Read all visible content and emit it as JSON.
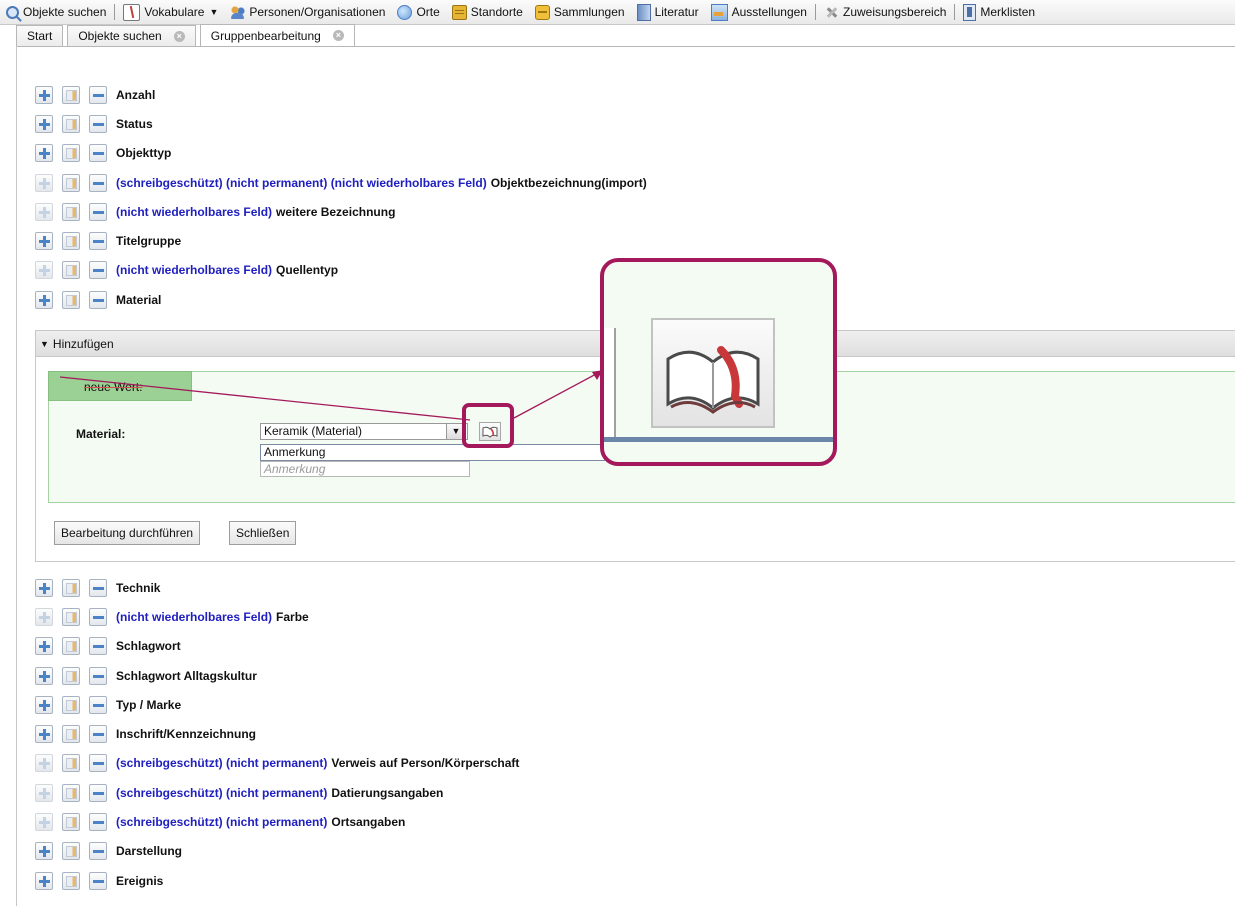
{
  "toolbar": {
    "items": [
      {
        "label": "Objekte suchen",
        "icon": "search-icon"
      },
      {
        "label": "Vokabulare",
        "icon": "book-icon",
        "dropdown": true
      },
      {
        "label": "Personen/Organisationen",
        "icon": "people-icon"
      },
      {
        "label": "Orte",
        "icon": "globe-icon"
      },
      {
        "label": "Standorte",
        "icon": "box-icon"
      },
      {
        "label": "Sammlungen",
        "icon": "collection-icon"
      },
      {
        "label": "Literatur",
        "icon": "literature-icon"
      },
      {
        "label": "Ausstellungen",
        "icon": "exhibition-icon"
      },
      {
        "label": "Zuweisungsbereich",
        "icon": "tools-icon"
      },
      {
        "label": "Merklisten",
        "icon": "watchlist-icon"
      }
    ]
  },
  "tabs": [
    {
      "label": "Start",
      "closable": false
    },
    {
      "label": "Objekte suchen",
      "closable": true
    },
    {
      "label": "Gruppenbearbeitung",
      "closable": true,
      "active": true
    }
  ],
  "fields_top": [
    {
      "prefix": "",
      "label": "Anzahl",
      "enabled": true
    },
    {
      "prefix": "",
      "label": "Status",
      "enabled": true
    },
    {
      "prefix": "",
      "label": "Objekttyp",
      "enabled": true
    },
    {
      "prefix": "(schreibgeschützt) (nicht permanent) (nicht wiederholbares Feld)",
      "label": "Objektbezeichnung(import)",
      "enabled": false
    },
    {
      "prefix": "(nicht wiederholbares Feld)",
      "label": "weitere Bezeichnung",
      "enabled": false
    },
    {
      "prefix": "",
      "label": "Titelgruppe",
      "enabled": true
    },
    {
      "prefix": "(nicht wiederholbares Feld)",
      "label": "Quellentyp",
      "enabled": false
    },
    {
      "prefix": "",
      "label": "Material",
      "enabled": true
    }
  ],
  "panel": {
    "header": "Hinzufügen",
    "new_value_tab": "neue Wert:",
    "material_label": "Material:",
    "material_value": "Keramik (Material)",
    "note_value": "Anmerkung",
    "note_placeholder": "Anmerkung",
    "btn_execute": "Bearbeitung durchführen",
    "btn_close": "Schließen"
  },
  "fields_bottom": [
    {
      "prefix": "",
      "label": "Technik",
      "enabled": true
    },
    {
      "prefix": "(nicht wiederholbares Feld)",
      "label": "Farbe",
      "enabled": false
    },
    {
      "prefix": "",
      "label": "Schlagwort",
      "enabled": true
    },
    {
      "prefix": "",
      "label": "Schlagwort Alltagskultur",
      "enabled": true
    },
    {
      "prefix": "",
      "label": "Typ / Marke",
      "enabled": true
    },
    {
      "prefix": "",
      "label": "Inschrift/Kennzeichnung",
      "enabled": true
    },
    {
      "prefix": "(schreibgeschützt) (nicht permanent)",
      "label": "Verweis auf Person/Körperschaft",
      "enabled": false
    },
    {
      "prefix": "(schreibgeschützt) (nicht permanent)",
      "label": "Datierungsangaben",
      "enabled": false
    },
    {
      "prefix": "(schreibgeschützt) (nicht permanent)",
      "label": "Ortsangaben",
      "enabled": false
    },
    {
      "prefix": "",
      "label": "Darstellung",
      "enabled": true
    },
    {
      "prefix": "",
      "label": "Ereignis",
      "enabled": true
    }
  ],
  "colors": {
    "highlight": "#a3195b",
    "prefix_text": "#2020c0",
    "panel_green": "#9bd194"
  }
}
